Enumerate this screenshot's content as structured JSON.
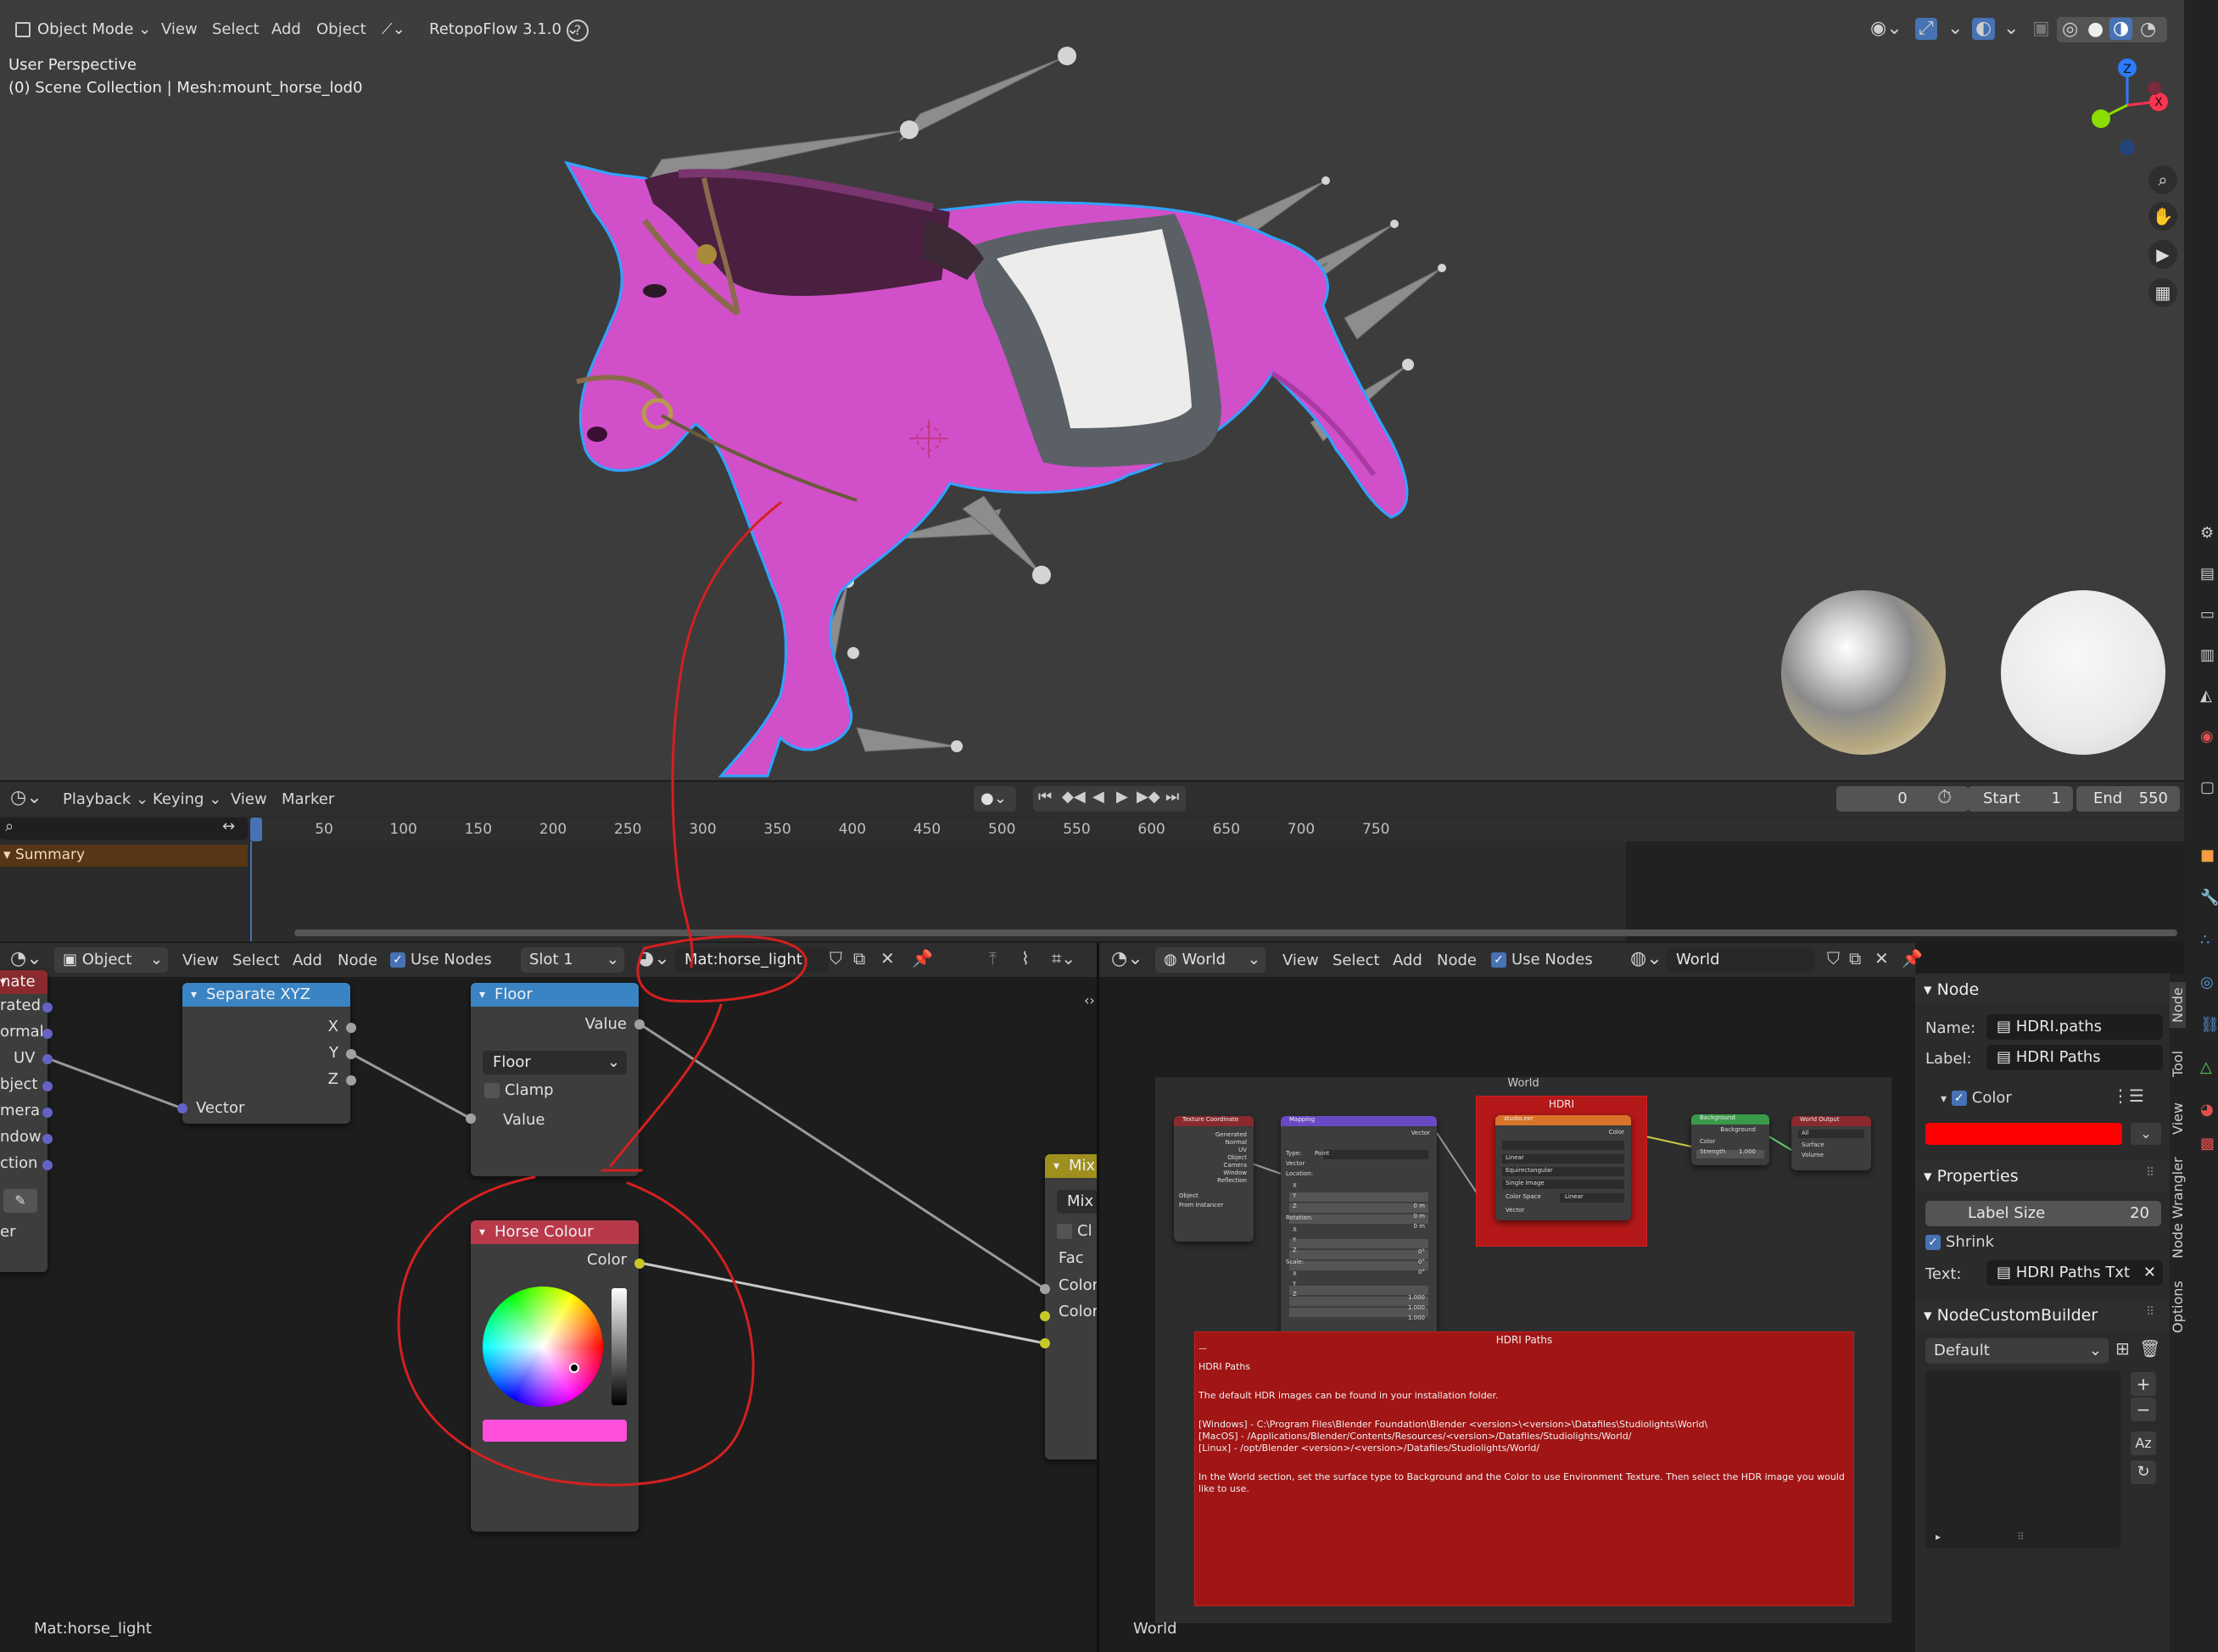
{
  "viewport": {
    "mode": "Object Mode",
    "menus": [
      "View",
      "Select",
      "Add",
      "Object"
    ],
    "addon": "RetopoFlow 3.1.0",
    "perspective": "User Perspective",
    "collection": "(0) Scene Collection | Mesh:mount_horse_lod0",
    "gizmo_axes": {
      "z": "Z",
      "x": "X"
    }
  },
  "timeline": {
    "menus": [
      "Playback",
      "Keying",
      "View",
      "Marker"
    ],
    "current_frame": "0",
    "start_label": "Start",
    "start_value": "1",
    "end_label": "End",
    "end_value": "550",
    "summary": "Summary",
    "ruler": [
      "50",
      "100",
      "150",
      "200",
      "250",
      "300",
      "350",
      "400",
      "450",
      "500",
      "550",
      "600",
      "650",
      "700",
      "750"
    ]
  },
  "shader_editor": {
    "type": "Object",
    "menus": [
      "View",
      "Select",
      "Add",
      "Node"
    ],
    "use_nodes": "Use Nodes",
    "slot": "Slot 1",
    "material": "Mat:horse_light",
    "footer": "Mat:horse_light",
    "partial_node_title": "inate",
    "partial_sockets": [
      "rated",
      "ormal",
      "UV",
      "bject",
      "mera",
      "ndow",
      "ction",
      "er"
    ],
    "separate_xyz": {
      "title": "Separate XYZ",
      "outputs": [
        "X",
        "Y",
        "Z"
      ],
      "input": "Vector"
    },
    "floor": {
      "title": "Floor",
      "output": "Value",
      "dropdown": "Floor",
      "clamp": "Clamp",
      "input": "Value"
    },
    "horse_colour": {
      "title": "Horse Colour",
      "output": "Color",
      "swatch": "#ff4fdc"
    },
    "mix": {
      "title": "Mix",
      "dropdown": "Mix",
      "clamp": "Cl",
      "inputs": [
        "Fac",
        "Color",
        "Color"
      ]
    }
  },
  "world_editor": {
    "type": "World",
    "menus": [
      "View",
      "Select",
      "Add",
      "Node"
    ],
    "use_nodes": "Use Nodes",
    "world_name": "World",
    "frame_label": "World",
    "hdri_frame_label": "HDRI",
    "mini_nodes": {
      "texcoord": {
        "title": "Texture Coordinate",
        "items": [
          "Generated",
          "Normal",
          "UV",
          "Object",
          "Camera",
          "Window",
          "Reflection",
          "Object",
          "From Instancer"
        ]
      },
      "mapping": {
        "title": "Mapping",
        "items": [
          "Vector",
          "Type:",
          "Point",
          "Vector",
          "Location:",
          "X",
          "Y",
          "Z",
          "Rotation:",
          "X",
          "Y",
          "Z",
          "Scale:",
          "X",
          "Y",
          "Z"
        ],
        "values": [
          "0 m",
          "0 m",
          "0 m",
          "0°",
          "0°",
          "0°",
          "1.000",
          "1.000",
          "1.000"
        ]
      },
      "env": {
        "title": "studio.exr",
        "items": [
          "Color",
          "Linear",
          "Equirectangular",
          "Single Image",
          "Color Space",
          "Linear",
          "Vector"
        ]
      },
      "background": {
        "title": "Background",
        "items": [
          "Background",
          "Color",
          "Strength",
          "1.000"
        ]
      },
      "world_output": {
        "title": "World Output",
        "items": [
          "All",
          "Surface",
          "Volume"
        ]
      }
    },
    "note": {
      "title": "HDRI Paths",
      "lines": [
        "HDRI Paths",
        "The default HDR images can be found in your installation folder.",
        "[Windows] - C:\\Program Files\\Blender Foundation\\Blender <version>\\<version>\\Datafiles\\Studiolights\\World\\",
        "[MacOS] - /Applications/Blender/Contents/Resources/<version>/Datafiles/Studiolights/World/",
        "[Linux] - /opt/Blender <version>/<version>/Datafiles/Studiolights/World/",
        "In the World section, set the surface type to Background and the Color to use Environment Texture. Then select the HDR image you would like to use."
      ]
    },
    "footer": "World"
  },
  "sidebar": {
    "node_header": "Node",
    "name_label": "Name:",
    "name_value": "HDRI.paths",
    "label_label": "Label:",
    "label_value": "HDRI Paths",
    "color_label": "Color",
    "color_value": "#ff0000",
    "properties_header": "Properties",
    "label_size_label": "Label Size",
    "label_size_value": "20",
    "shrink_label": "Shrink",
    "text_label": "Text:",
    "text_value": "HDRI Paths Txt",
    "ncb_header": "NodeCustomBuilder",
    "ncb_dropdown": "Default",
    "tabs": [
      "Node",
      "Tool",
      "View",
      "Node Wrangler",
      "Options"
    ]
  },
  "colors": {
    "accent_blue": "#4772b3",
    "selection_outline": "#2fa3ff",
    "horse": "#d14fc9",
    "annotation": "#d42020"
  }
}
